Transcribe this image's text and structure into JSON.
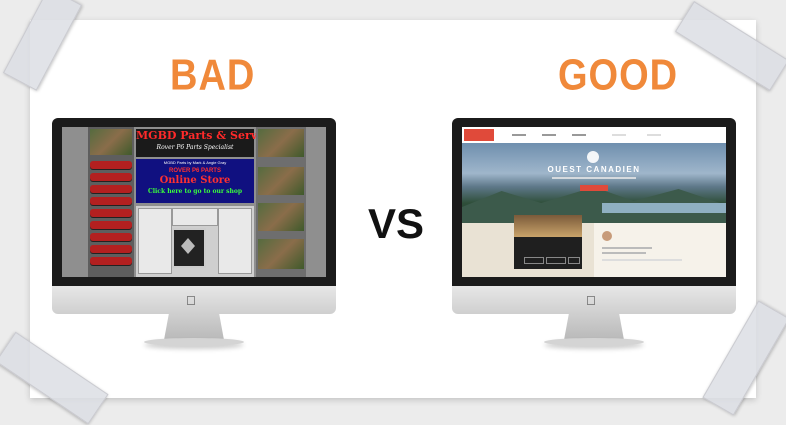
{
  "headings": {
    "bad": "BAD",
    "good": "GOOD",
    "vs": "VS"
  },
  "bad_site": {
    "title": "MGBD Parts & Services",
    "subtitle": "Rover P6 Parts Specialist",
    "store_line1": "MGBD Parts by Mark & Angie Gray",
    "store_line2": "ROVER P6 PARTS",
    "store_line3": "Online Store",
    "store_line4": "Click here to go to our shop"
  },
  "good_site": {
    "title": "OUEST CANADIEN"
  },
  "colors": {
    "accent": "#f0893a",
    "good_brand": "#e04a3a",
    "bad_title": "#ff2a2a"
  },
  "icons": {
    "monitor_logo": "apple-icon"
  }
}
